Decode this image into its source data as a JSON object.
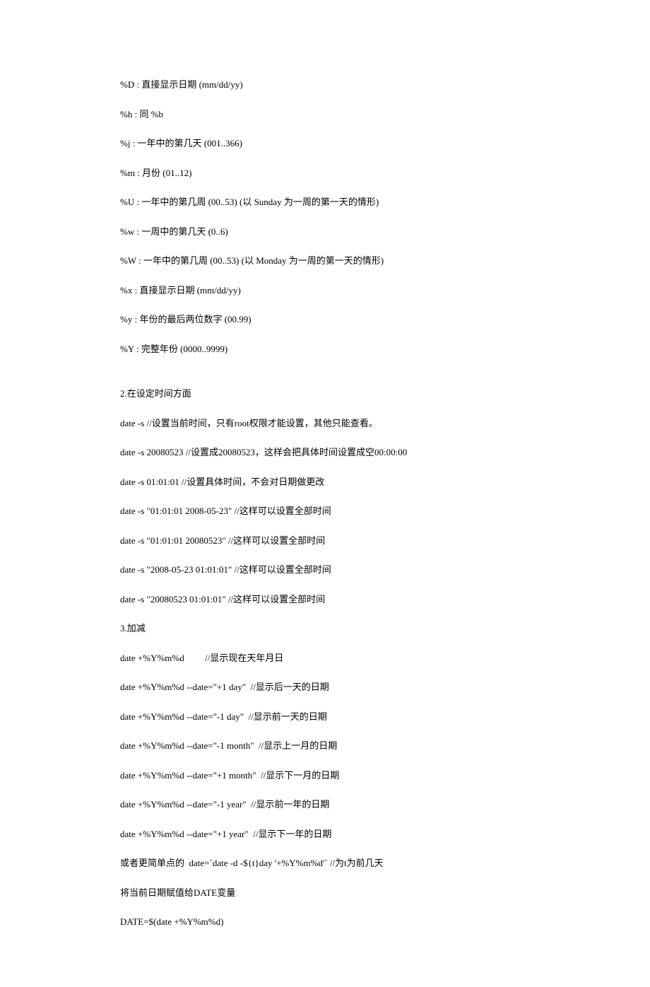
{
  "lines": [
    {
      "text": "%D : 直接显示日期 (mm/dd/yy)"
    },
    {
      "text": "%h : 同 %b"
    },
    {
      "text": "%j : 一年中的第几天 (001..366)"
    },
    {
      "text": "%m : 月份 (01..12)"
    },
    {
      "text": "%U : 一年中的第几周 (00..53) (以 Sunday 为一周的第一天的情形)"
    },
    {
      "text": "%w : 一周中的第几天 (0..6)"
    },
    {
      "text": "%W : 一年中的第几周 (00..53) (以 Monday 为一周的第一天的情形)"
    },
    {
      "text": "%x : 直接显示日期 (mm/dd/yy)"
    },
    {
      "text": "%y : 年份的最后两位数字 (00.99)"
    },
    {
      "text": "%Y : 完整年份 (0000..9999)"
    },
    {
      "text": "2.在设定时间方面",
      "gap": true
    },
    {
      "text": "date -s //设置当前时间，只有root权限才能设置，其他只能查看。"
    },
    {
      "text": "date -s 20080523 //设置成20080523，这样会把具体时间设置成空00:00:00"
    },
    {
      "text": "date -s 01:01:01 //设置具体时间，不会对日期做更改"
    },
    {
      "text": "date -s \"01:01:01 2008-05-23\" //这样可以设置全部时间"
    },
    {
      "text": "date -s \"01:01:01 20080523\" //这样可以设置全部时间"
    },
    {
      "text": "date -s \"2008-05-23 01:01:01\" //这样可以设置全部时间"
    },
    {
      "text": "date -s \"20080523 01:01:01\" //这样可以设置全部时间"
    },
    {
      "text": "3.加减"
    },
    {
      "text": "date +%Y%m%d         //显示现在天年月日"
    },
    {
      "text": "date +%Y%m%d --date=\"+1 day\"  //显示后一天的日期"
    },
    {
      "text": "date +%Y%m%d --date=\"-1 day\"  //显示前一天的日期"
    },
    {
      "text": "date +%Y%m%d --date=\"-1 month\"  //显示上一月的日期"
    },
    {
      "text": "date +%Y%m%d --date=\"+1 month\"  //显示下一月的日期"
    },
    {
      "text": "date +%Y%m%d --date=\"-1 year\"  //显示前一年的日期"
    },
    {
      "text": "date +%Y%m%d --date=\"+1 year\"  //显示下一年的日期"
    },
    {
      "text": "或者更简单点的  date=`date -d -${t}day '+%Y%m%d'` //为t为前几天"
    },
    {
      "text": "将当前日期赋值给DATE变量"
    },
    {
      "text": "DATE=$(date +%Y%m%d)"
    }
  ]
}
